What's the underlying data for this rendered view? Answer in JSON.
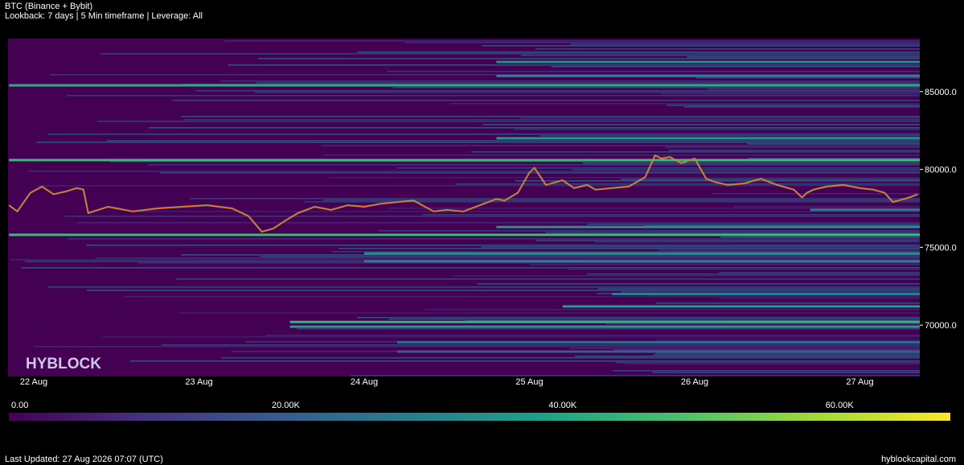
{
  "header": {
    "title": "BTC (Binance + Bybit)",
    "subtitle": "Lookback: 7 days | 5 Min timeframe | Leverage: All"
  },
  "footer": {
    "updated": "Last Updated: 27 Aug 2026 07:07 (UTC)",
    "site": "hyblockcapital.com"
  },
  "watermark": "HYBLOCK",
  "colors": {
    "background": "#000000",
    "colormap": [
      "#440154",
      "#46327e",
      "#365c8d",
      "#277f8e",
      "#1fa187",
      "#4ac16d",
      "#a0da39",
      "#fde725"
    ],
    "price_line": "#e8742a",
    "price_line_alt": "#7fc06a"
  },
  "chart_data": {
    "type": "heatmap",
    "x_tick_labels": [
      "22 Aug",
      "23 Aug",
      "24 Aug",
      "25 Aug",
      "26 Aug",
      "27 Aug"
    ],
    "x_range_days": [
      0.85,
      6.35
    ],
    "y_ticks": [
      70000,
      75000,
      80000,
      85000
    ],
    "y_tick_labels": [
      "70000.0",
      "75000.0",
      "80000.0",
      "85000.0"
    ],
    "ylim": [
      66700,
      88400
    ],
    "colorbar": {
      "range": [
        0,
        68000
      ],
      "ticks": [
        0,
        20000,
        40000,
        60000
      ],
      "tick_labels": [
        "0.00",
        "20.00K",
        "40.00K",
        "60.00K"
      ]
    },
    "liquidation_bands": [
      {
        "price": 85400,
        "value": 42000,
        "start_day": 0.85
      },
      {
        "price": 80600,
        "value": 46000,
        "start_day": 0.85
      },
      {
        "price": 75800,
        "value": 46000,
        "start_day": 0.85
      },
      {
        "price": 70200,
        "value": 44000,
        "start_day": 2.55
      },
      {
        "price": 69900,
        "value": 38000,
        "start_day": 2.55
      },
      {
        "price": 86900,
        "value": 34000,
        "start_day": 3.8
      },
      {
        "price": 86000,
        "value": 30000,
        "start_day": 3.8
      },
      {
        "price": 82000,
        "value": 36000,
        "start_day": 3.8
      },
      {
        "price": 76300,
        "value": 34000,
        "start_day": 3.8
      },
      {
        "price": 74600,
        "value": 34000,
        "start_day": 3.0
      },
      {
        "price": 74100,
        "value": 30000,
        "start_day": 3.0
      },
      {
        "price": 71200,
        "value": 38000,
        "start_day": 4.2
      },
      {
        "price": 72000,
        "value": 30000,
        "start_day": 4.5
      },
      {
        "price": 68900,
        "value": 24000,
        "start_day": 3.2
      },
      {
        "price": 68300,
        "value": 20000,
        "start_day": 3.2
      },
      {
        "price": 77400,
        "value": 28000,
        "start_day": 5.7
      }
    ],
    "price_series": {
      "x_days": [
        0.85,
        0.9,
        0.98,
        1.05,
        1.12,
        1.2,
        1.26,
        1.3,
        1.33,
        1.45,
        1.6,
        1.75,
        1.9,
        2.05,
        2.2,
        2.3,
        2.38,
        2.45,
        2.52,
        2.6,
        2.7,
        2.8,
        2.9,
        3.0,
        3.1,
        3.2,
        3.3,
        3.42,
        3.5,
        3.6,
        3.7,
        3.8,
        3.85,
        3.93,
        4.0,
        4.03,
        4.1,
        4.2,
        4.27,
        4.35,
        4.4,
        4.5,
        4.6,
        4.7,
        4.76,
        4.8,
        4.85,
        4.92,
        5.0,
        5.07,
        5.12,
        5.2,
        5.3,
        5.4,
        5.5,
        5.6,
        5.65,
        5.68,
        5.72,
        5.8,
        5.9,
        6.0,
        6.08,
        6.15,
        6.2,
        6.3,
        6.35
      ],
      "values": [
        77700,
        77300,
        78500,
        78900,
        78400,
        78600,
        78800,
        78700,
        77200,
        77600,
        77300,
        77500,
        77600,
        77700,
        77500,
        77000,
        76000,
        76200,
        76700,
        77200,
        77600,
        77400,
        77700,
        77600,
        77800,
        77900,
        78000,
        77300,
        77400,
        77300,
        77700,
        78100,
        78000,
        78500,
        79800,
        80100,
        79000,
        79300,
        78800,
        79000,
        78700,
        78800,
        78900,
        79500,
        80900,
        80700,
        80800,
        80400,
        80700,
        79400,
        79200,
        79000,
        79100,
        79400,
        79000,
        78700,
        78200,
        78500,
        78700,
        78900,
        79000,
        78800,
        78700,
        78500,
        77900,
        78200,
        78400
      ]
    }
  }
}
